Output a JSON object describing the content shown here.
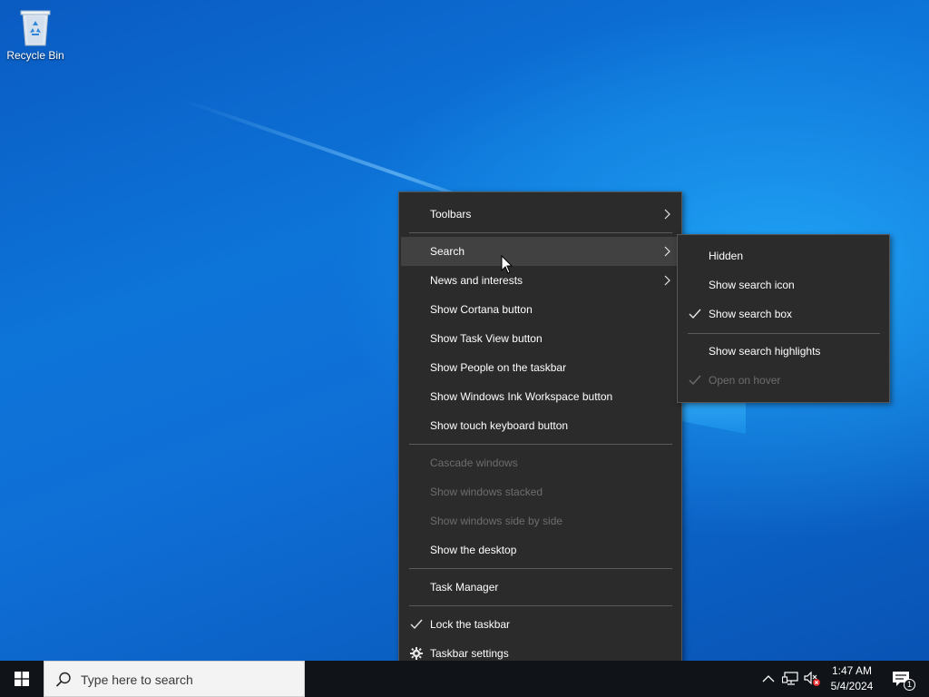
{
  "desktop": {
    "recycle_bin_label": "Recycle Bin"
  },
  "context_menu": {
    "items": [
      {
        "label": "Toolbars",
        "has_submenu": true
      },
      {
        "label": "Search",
        "has_submenu": true,
        "state": "hovered"
      },
      {
        "label": "News and interests",
        "has_submenu": true
      },
      {
        "label": "Show Cortana button"
      },
      {
        "label": "Show Task View button"
      },
      {
        "label": "Show People on the taskbar"
      },
      {
        "label": "Show Windows Ink Workspace button"
      },
      {
        "label": "Show touch keyboard button"
      },
      {
        "label": "Cascade windows",
        "disabled": true
      },
      {
        "label": "Show windows stacked",
        "disabled": true
      },
      {
        "label": "Show windows side by side",
        "disabled": true
      },
      {
        "label": "Show the desktop"
      },
      {
        "label": "Task Manager"
      },
      {
        "label": "Lock the taskbar",
        "checked": true
      },
      {
        "label": "Taskbar settings",
        "icon": "gear-icon"
      }
    ]
  },
  "search_submenu": {
    "items": [
      {
        "label": "Hidden"
      },
      {
        "label": "Show search icon"
      },
      {
        "label": "Show search box",
        "checked": true
      },
      {
        "label": "Show search highlights"
      },
      {
        "label": "Open on hover",
        "checked": true,
        "disabled": true
      }
    ]
  },
  "taskbar": {
    "search_placeholder": "Type here to search",
    "clock_time": "1:47 AM",
    "clock_date": "5/4/2024",
    "notification_count": "1",
    "icons": [
      "windows-logo-icon",
      "search-icon",
      "chevron-up-icon",
      "network-icon",
      "volume-muted-icon",
      "action-center-icon"
    ]
  },
  "colors": {
    "menu_bg": "#2b2b2b",
    "menu_hover": "#414141",
    "disabled_text": "#6d6d6d",
    "taskbar_bg": "#101419"
  }
}
